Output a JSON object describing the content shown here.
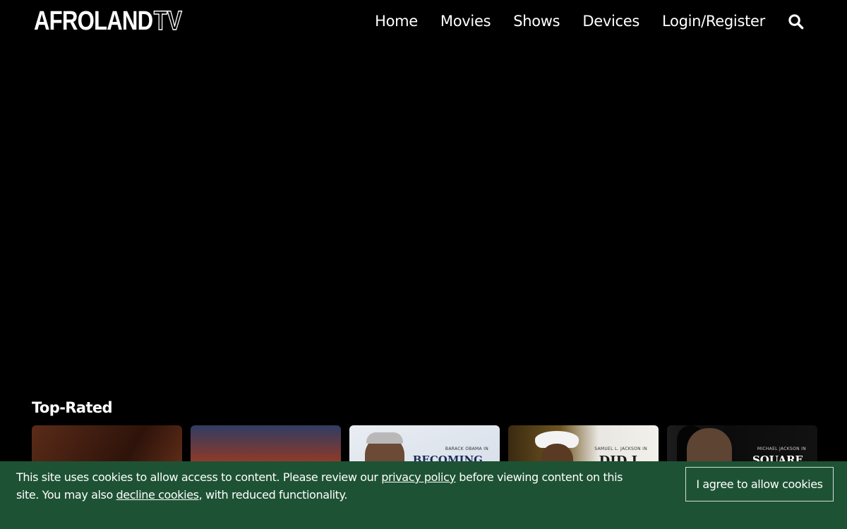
{
  "header": {
    "logo_main": "AFROLAND",
    "logo_tv": "TV",
    "nav": [
      {
        "label": "Home"
      },
      {
        "label": "Movies"
      },
      {
        "label": "Shows"
      },
      {
        "label": "Devices"
      },
      {
        "label": "Login/Register"
      }
    ],
    "search_icon": "search-icon"
  },
  "main": {
    "section_title": "Top-Rated",
    "cards": [
      {
        "caption": "",
        "title": ""
      },
      {
        "caption": "",
        "title": ""
      },
      {
        "caption": "BARACK OBAMA  IN",
        "title": "BECOMING"
      },
      {
        "caption": "SAMUEL L. JACKSON IN",
        "title": "DID I"
      },
      {
        "caption": "MICHAEL JACKSON IN",
        "title": "SQUARE"
      }
    ]
  },
  "cookie_banner": {
    "text_before": "This site uses cookies to allow access to content. Please review our ",
    "privacy_link": "privacy policy",
    "text_middle": " before viewing content on this site. You may also ",
    "decline_link": "decline cookies",
    "text_after": ", with reduced functionality.",
    "agree_label": "I agree to allow cookies"
  },
  "colors": {
    "background": "#000000",
    "banner": "#1e5234",
    "text": "#ffffff"
  }
}
